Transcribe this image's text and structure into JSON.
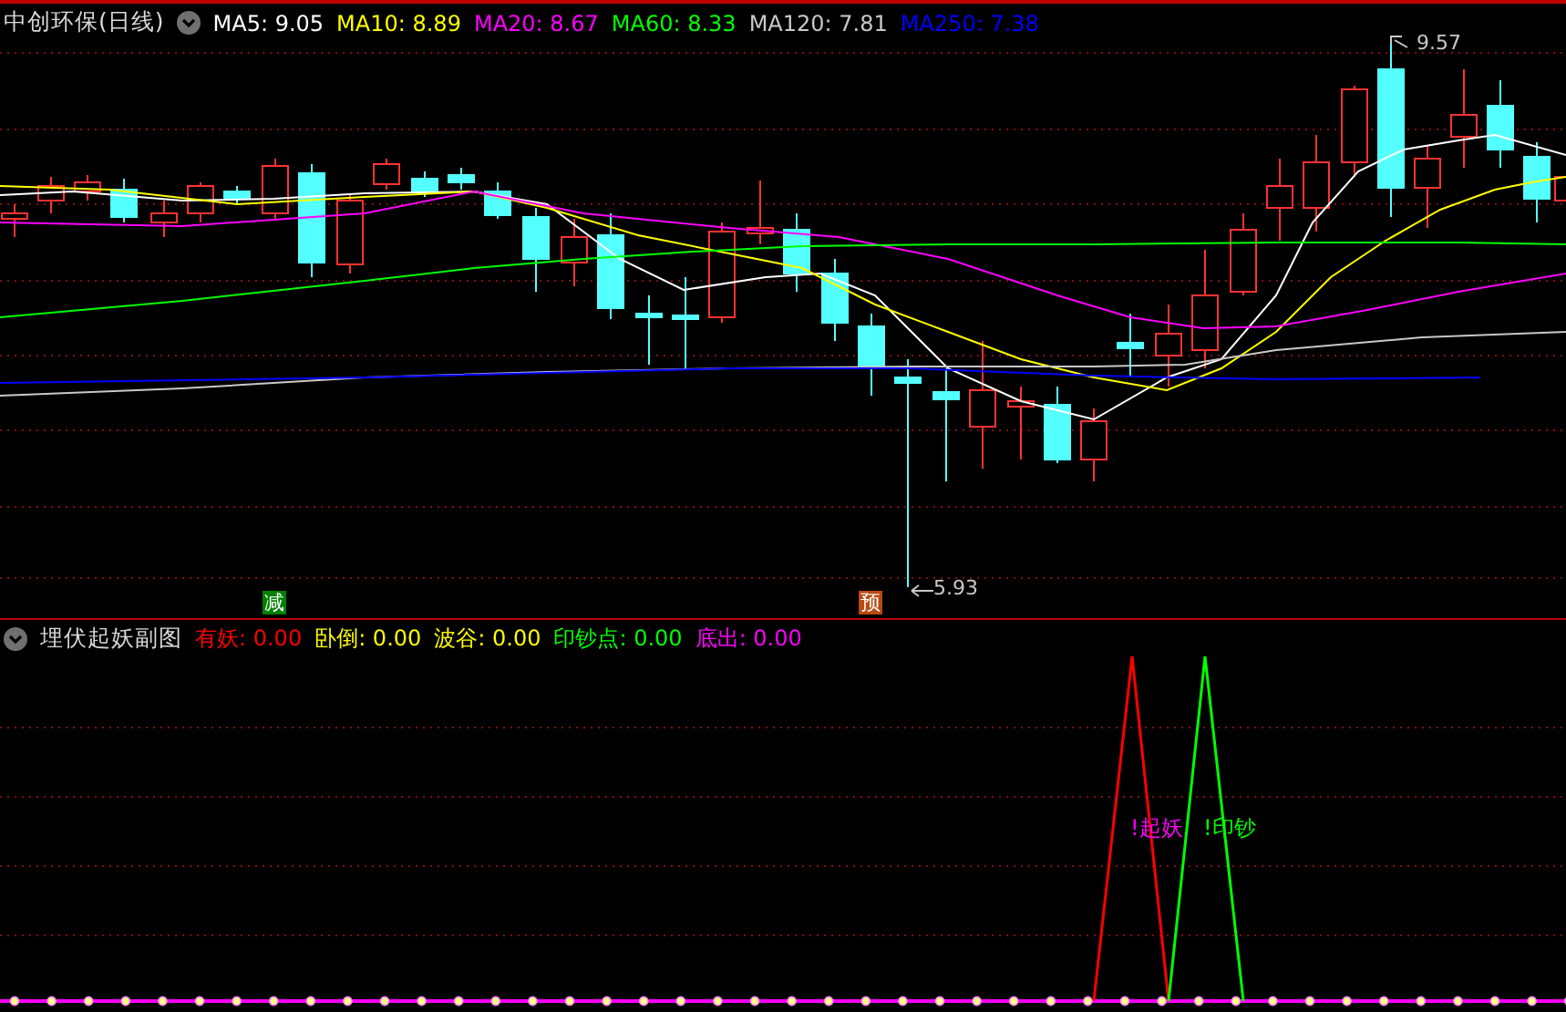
{
  "main_pane": {
    "title": "中创环保(日线)",
    "indicators": [
      {
        "label": "MA5: 9.05",
        "color": "#ffffff"
      },
      {
        "label": "MA10: 8.89",
        "color": "#ffff00"
      },
      {
        "label": "MA20: 8.67",
        "color": "#ff00ff"
      },
      {
        "label": "MA60: 8.33",
        "color": "#00ff00"
      },
      {
        "label": "MA120: 7.81",
        "color": "#c8c8c8"
      },
      {
        "label": "MA250: 7.38",
        "color": "#0000ff"
      }
    ],
    "high_label": "9.57",
    "low_label": "5.93",
    "markers": [
      {
        "text": "减",
        "color": "#007f00"
      },
      {
        "text": "预",
        "color": "#b84a10"
      }
    ]
  },
  "sub_pane": {
    "title": "埋伏起妖副图",
    "indicators": [
      {
        "label": "有妖: 0.00",
        "color": "#ff0000"
      },
      {
        "label": "卧倒: 0.00",
        "color": "#ffff00"
      },
      {
        "label": "波谷: 0.00",
        "color": "#ffff00"
      },
      {
        "label": "印钞点: 0.00",
        "color": "#00ff00"
      },
      {
        "label": "底出: 0.00",
        "color": "#ff00ff"
      }
    ],
    "signals": [
      {
        "text": "!起妖",
        "color": "#ff00ff"
      },
      {
        "text": "!印钞",
        "color": "#00ff00"
      }
    ]
  }
}
